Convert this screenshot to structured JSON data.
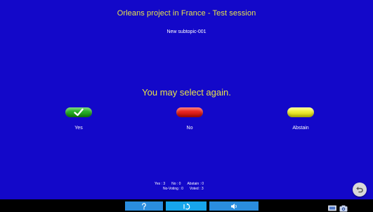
{
  "header": {
    "title": "Orleans project in France - Test session",
    "subtopic": "New subtopic-001"
  },
  "prompt": "You may select again.",
  "options": {
    "yes": {
      "label": "Yes",
      "color": "#22a81f"
    },
    "no": {
      "label": "No",
      "color": "#e81814"
    },
    "abstain": {
      "label": "Abstain",
      "color": "#f0ee1c"
    }
  },
  "tally": {
    "yes": "Yes : 3",
    "no": "No : 0",
    "abstain": "Abstain : 0",
    "no_voting": "No-Voting : 0",
    "voted": "Voted : 3"
  },
  "icons": {
    "back": "back-arrow-icon",
    "help": "question-icon",
    "reload": "reload-icon",
    "sound": "speaker-icon",
    "screen": "screen-icon",
    "camera": "camera-icon"
  },
  "colors": {
    "background": "#1308c9",
    "title_text": "#e7e24a",
    "bottom_bar": "#000000",
    "nav_button": "#2a8ddf",
    "nav_button_active": "#17a6ec"
  }
}
